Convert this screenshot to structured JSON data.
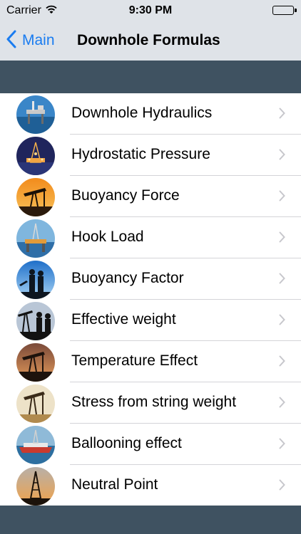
{
  "status_bar": {
    "carrier": "Carrier",
    "time": "9:30 PM"
  },
  "nav": {
    "back_label": "Main",
    "title": "Downhole Formulas"
  },
  "rows": [
    {
      "label": "Downhole Hydraulics",
      "icon": "offshore-platform-thumbnail"
    },
    {
      "label": "Hydrostatic Pressure",
      "icon": "rig-at-night-thumbnail"
    },
    {
      "label": "Buoyancy Force",
      "icon": "pumpjack-sunset-thumbnail"
    },
    {
      "label": "Hook Load",
      "icon": "offshore-rig-thumbnail"
    },
    {
      "label": "Buoyancy Factor",
      "icon": "workers-silhouette-thumbnail"
    },
    {
      "label": "Effective weight",
      "icon": "pumpjack-handshake-thumbnail"
    },
    {
      "label": "Temperature Effect",
      "icon": "pumpjack-dusk-thumbnail"
    },
    {
      "label": "Stress from string weight",
      "icon": "pumpjack-field-thumbnail"
    },
    {
      "label": "Ballooning effect",
      "icon": "drillship-thumbnail"
    },
    {
      "label": "Neutral Point",
      "icon": "derrick-sunset-thumbnail"
    }
  ],
  "colors": {
    "accent": "#1a7cf0",
    "band": "#3f5261",
    "bar": "#dfe3e8"
  }
}
